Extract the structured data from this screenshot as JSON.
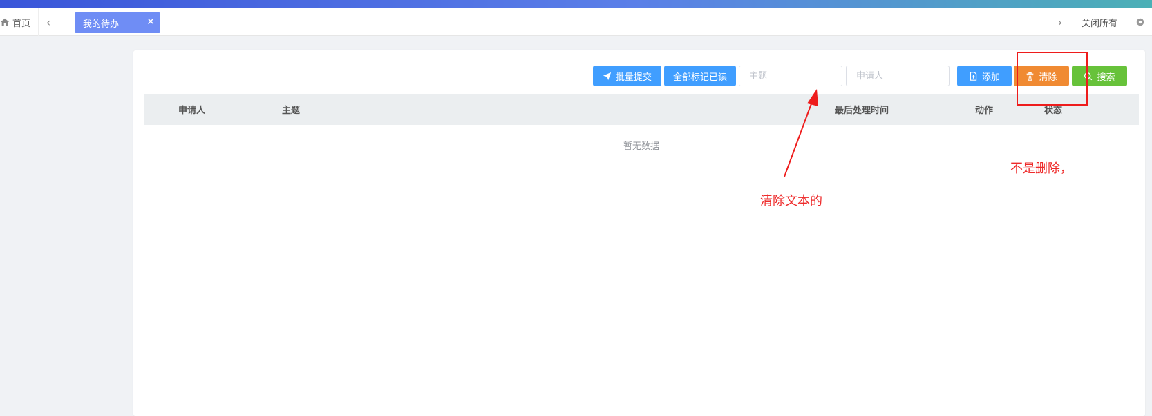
{
  "tags_bar": {
    "home_label": "首页",
    "active_tab_label": "我的待办",
    "close_all_label": "关闭所有"
  },
  "toolbar": {
    "batch_submit_label": "批量提交",
    "mark_all_read_label": "全部标记已读",
    "subject_placeholder": "主题",
    "applicant_placeholder": "申请人",
    "add_label": "添加",
    "clear_label": "清除",
    "search_label": "搜索"
  },
  "table": {
    "columns": [
      "申请人",
      "主题",
      "最后处理时间",
      "动作",
      "状态"
    ],
    "empty_text": "暂无数据"
  },
  "annotations": {
    "clear_text_note": "清除文本的",
    "not_delete_note": "不是删除，"
  },
  "colors": {
    "primary": "#409eff",
    "warning": "#f08a32",
    "success": "#67c23a",
    "active_tab": "#6f8df5",
    "annotation_red": "#ee2a2a"
  },
  "icons": [
    "home-icon",
    "chevron-left-icon",
    "close-icon",
    "chevron-right-icon",
    "settings-icon",
    "send-icon",
    "document-add-icon",
    "trash-icon",
    "search-icon"
  ]
}
